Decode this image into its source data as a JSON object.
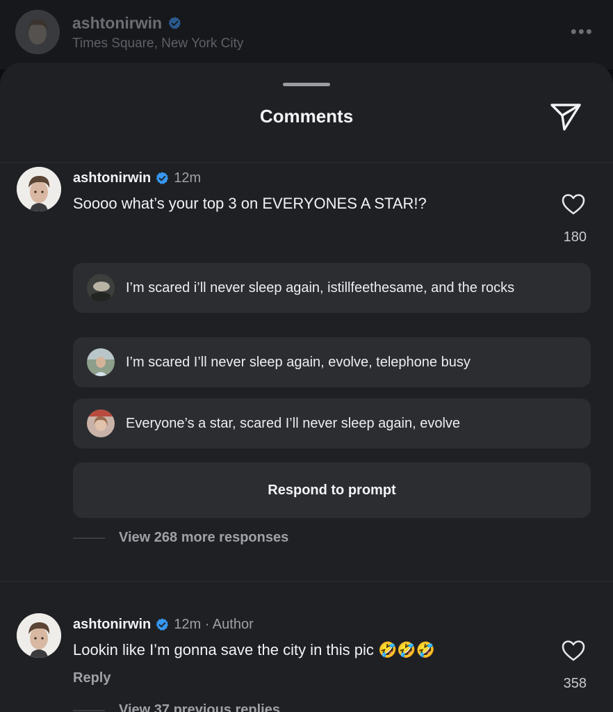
{
  "post_header": {
    "username": "ashtonirwin",
    "location": "Times Square, New York City",
    "more": "•••"
  },
  "sheet": {
    "title": "Comments"
  },
  "comments": [
    {
      "username": "ashtonirwin",
      "time": "12m",
      "text": "Soooo what’s your top 3 on EVERYONES A STAR!?",
      "likes": "180",
      "responses": [
        {
          "text": "I’m scared i’ll never sleep again, istillfeethesame, and the rocks"
        },
        {
          "text": "I’m scared I’ll never sleep again, evolve, telephone busy"
        },
        {
          "text": "Everyone’s a star, scared I’ll never sleep again, evolve"
        }
      ],
      "respond_button": "Respond to prompt",
      "view_more": "View 268 more responses"
    },
    {
      "username": "ashtonirwin",
      "time": "12m · Author",
      "text": "Lookin like I’m gonna save the city in this pic",
      "emojis": "🤣🤣🤣",
      "likes": "358",
      "reply": "Reply",
      "view_more": "View 37 previous replies"
    }
  ],
  "colors": {
    "sheet_bg": "#1f2024",
    "card_bg": "#2b2d31",
    "verified_blue": "#3797f0",
    "muted_text": "#9ea1a6"
  }
}
